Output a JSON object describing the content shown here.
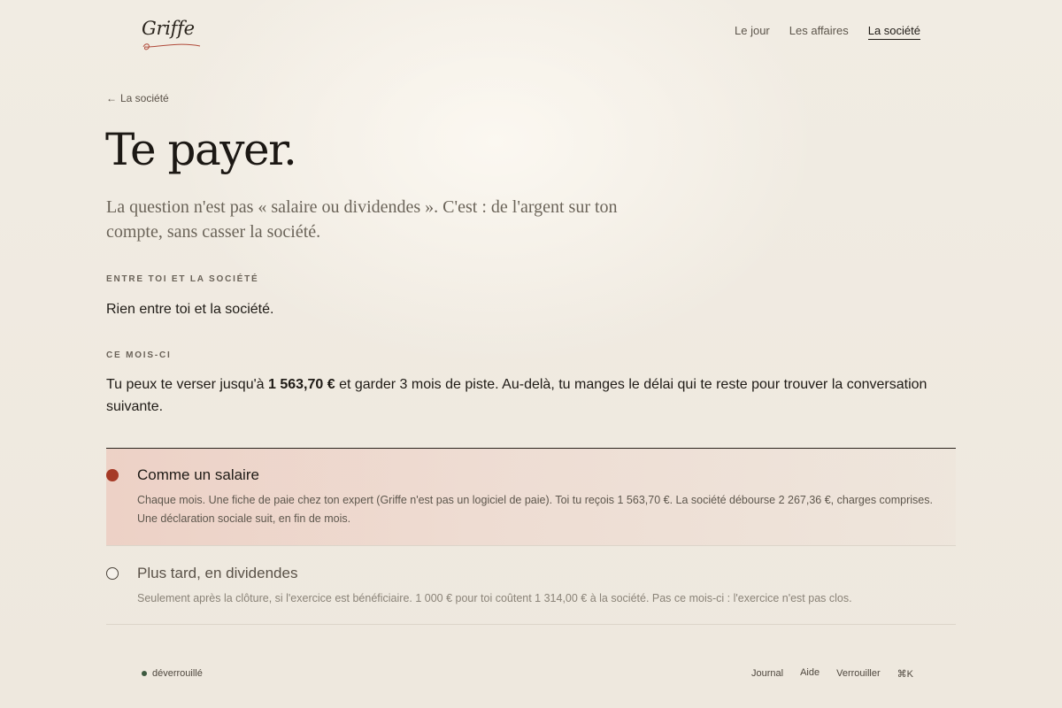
{
  "brand": {
    "name": "Griffe"
  },
  "nav": {
    "items": [
      {
        "label": "Le jour"
      },
      {
        "label": "Les affaires"
      },
      {
        "label": "La société"
      }
    ]
  },
  "back": {
    "label": "La société"
  },
  "page": {
    "title": "Te payer.",
    "lead": "La question n'est pas « salaire ou dividendes ». C'est : de l'argent sur ton compte, sans casser la société."
  },
  "between": {
    "eyebrow": "ENTRE TOI ET LA SOCIÉTÉ",
    "text": "Rien entre toi et la société."
  },
  "month": {
    "eyebrow": "CE MOIS-CI",
    "text_before": "Tu peux te verser jusqu'à ",
    "amount": "1 563,70 €",
    "text_after": " et garder 3 mois de piste. Au-delà, tu manges le délai qui te reste pour trouver la conversation suivante."
  },
  "options": [
    {
      "title": "Comme un salaire",
      "description": "Chaque mois. Une fiche de paie chez ton expert (Griffe n'est pas un logiciel de paie). Toi tu reçois 1 563,70 €. La société débourse 2 267,36 €, charges comprises. Une déclaration sociale suit, en fin de mois.",
      "selected": true
    },
    {
      "title": "Plus tard, en dividendes",
      "description": "Seulement après la clôture, si l'exercice est bénéficiaire. 1 000 € pour toi coûtent 1 314,00 € à la société. Pas ce mois-ci : l'exercice n'est pas clos.",
      "selected": false
    }
  ],
  "footer": {
    "status": "déverrouillé",
    "links": [
      "Journal",
      "Aide",
      "Verrouiller",
      "⌘K"
    ]
  },
  "colors": {
    "accent": "#a63a26",
    "status_dot": "#3d5a40",
    "background": "#efe9df"
  }
}
